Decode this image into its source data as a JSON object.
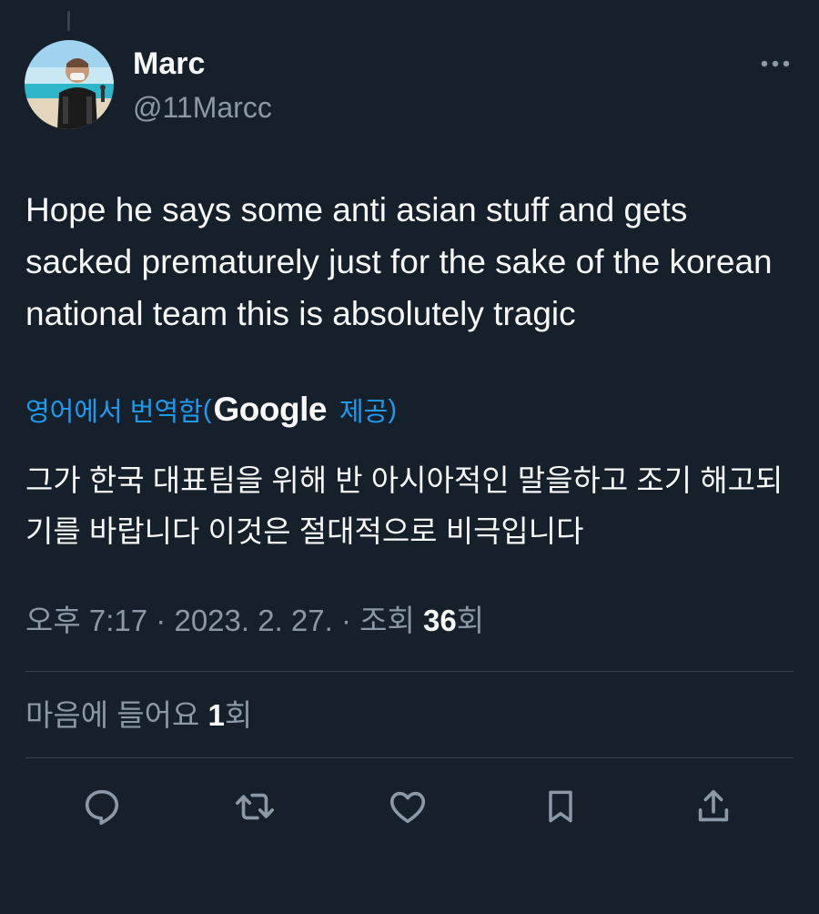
{
  "author": {
    "name": "Marc",
    "handle": "@11Marcc"
  },
  "tweet": {
    "text": "Hope he says some anti asian stuff and gets sacked prematurely just for the sake of the korean national team this is absolutely tragic"
  },
  "translation": {
    "link_label": "영어에서 번역함",
    "provider_brand": "Google",
    "provided_label": "제공",
    "open_paren": "(",
    "close_paren": ")",
    "text": "그가 한국 대표팀을 위해 반 아시아적인 말을하고 조기 해고되기를 바랍니다 이것은 절대적으로 비극입니다"
  },
  "meta": {
    "time": "오후 7:17",
    "separator": "·",
    "date": "2023. 2. 27.",
    "views_label": "조회",
    "views_count": "36",
    "views_suffix": "회"
  },
  "likes": {
    "label": "마음에 들어요",
    "count": "1",
    "suffix": "회"
  },
  "actions": {
    "reply_icon": "reply-icon",
    "retweet_icon": "retweet-icon",
    "like_icon": "heart-icon",
    "bookmark_icon": "bookmark-icon",
    "share_icon": "share-icon"
  },
  "colors": {
    "background": "#15202b",
    "primary_text": "#f7f9f9",
    "secondary_text": "#8b98a5",
    "link": "#1d9bf0",
    "divider": "#38444d"
  }
}
